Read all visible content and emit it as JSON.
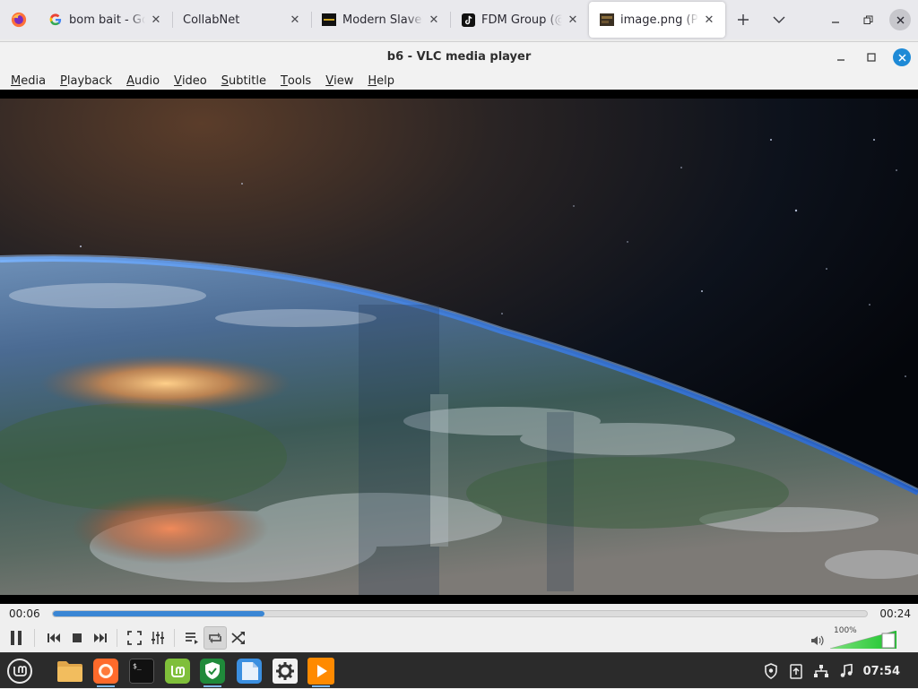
{
  "browser": {
    "tabs": [
      {
        "title": "bom bait - Goog",
        "favicon": "google-icon"
      },
      {
        "title": "CollabNet",
        "favicon": "none"
      },
      {
        "title": "Modern Slavery",
        "favicon": "site-icon"
      },
      {
        "title": "FDM Group (@F",
        "favicon": "tiktok-icon"
      },
      {
        "title": "image.png (PNG",
        "favicon": "image-icon",
        "active": true
      }
    ],
    "new_tab_icon": "plus-icon",
    "list_tabs_icon": "chevron-down-icon"
  },
  "vlc": {
    "title": "b6 - VLC media player",
    "menu": [
      {
        "first": "M",
        "rest": "edia"
      },
      {
        "first": "P",
        "rest": "layback"
      },
      {
        "first": "A",
        "rest": "udio"
      },
      {
        "first": "V",
        "rest": "ideo"
      },
      {
        "first": "S",
        "rest": "ubtitle"
      },
      {
        "first": "T",
        "rest": "ools"
      },
      {
        "first": "V",
        "rest": "iew"
      },
      {
        "first": "H",
        "rest": "elp"
      }
    ],
    "time_elapsed": "00:06",
    "time_total": "00:24",
    "progress": 0.26,
    "volume_label": "100%",
    "volume_level": 1.0,
    "accent": "#3a86d4",
    "volume_color": "#2fd13a"
  },
  "taskbar": {
    "apps": [
      "mint-menu-icon",
      "files-icon",
      "firefox-icon",
      "terminal-icon",
      "mint-update-icon",
      "shield-icon",
      "document-viewer-icon",
      "settings-icon",
      "vlc-icon"
    ],
    "clock": "07:54"
  }
}
